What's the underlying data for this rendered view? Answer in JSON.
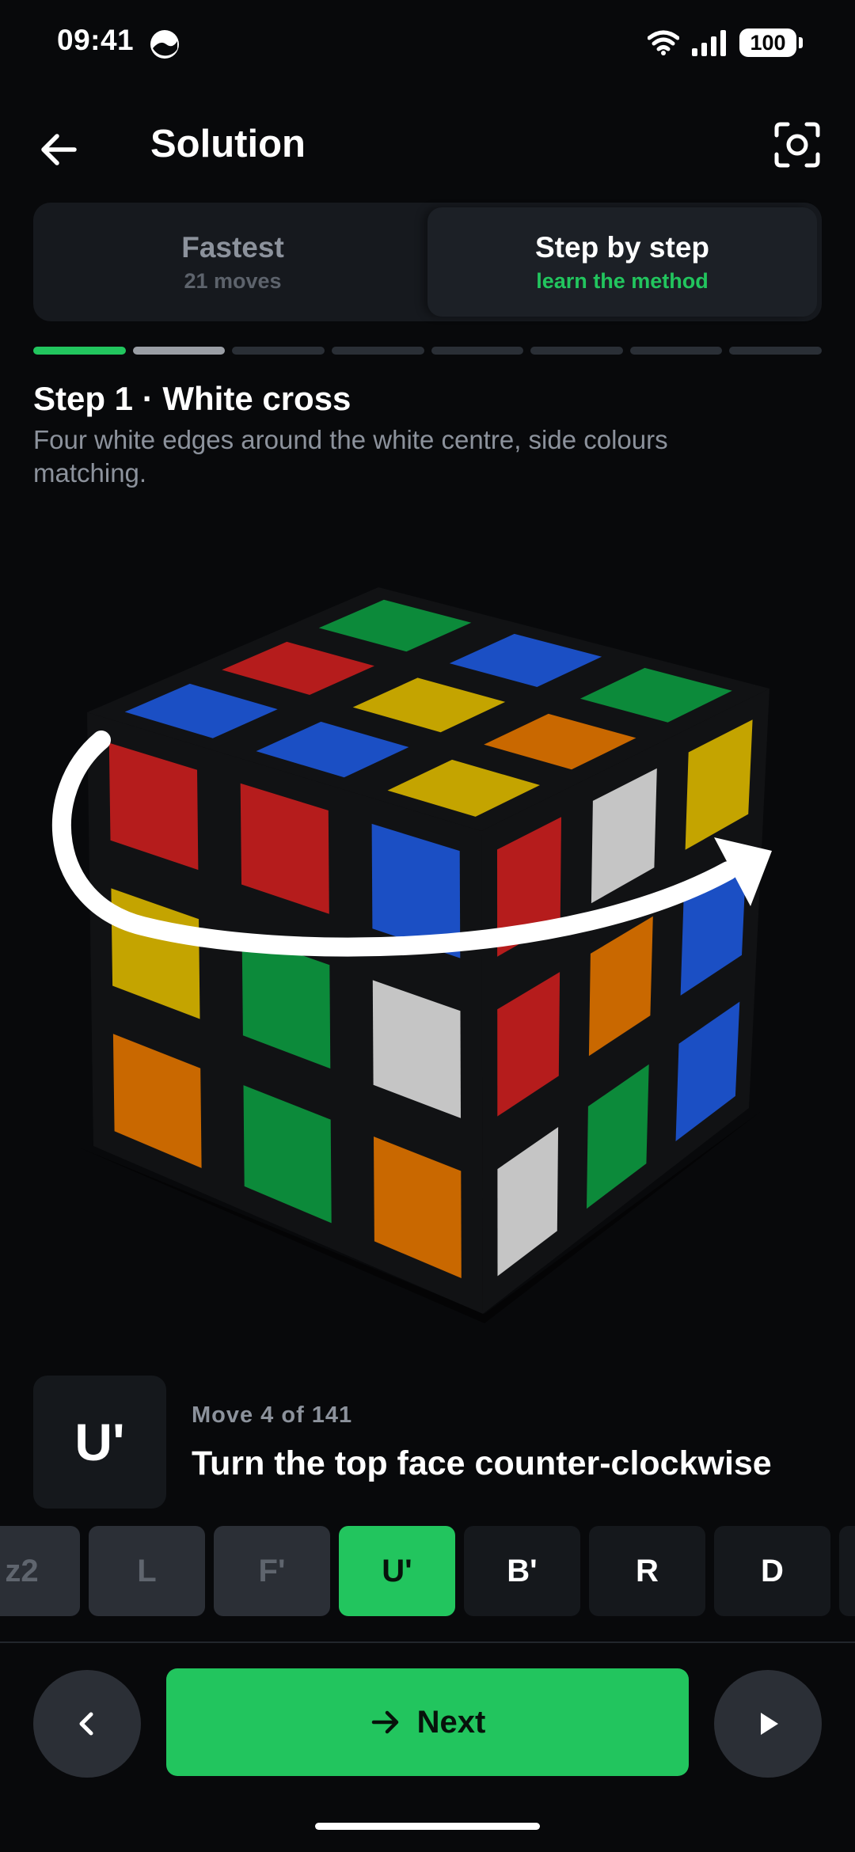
{
  "status_bar": {
    "time": "09:41",
    "battery": "100"
  },
  "header": {
    "title": "Solution"
  },
  "tabs": [
    {
      "label": "Fastest",
      "sub": "21 moves",
      "active": false
    },
    {
      "label": "Step by step",
      "sub": "learn the method",
      "active": true
    }
  ],
  "step_progress": {
    "total": 8,
    "done": 1,
    "current": 2
  },
  "step": {
    "title": "Step 1 · White cross",
    "description": "Four white edges around the white centre, side colours matching."
  },
  "move": {
    "notation": "U'",
    "counter": "Move 4 of 141",
    "description": "Turn the top face counter-clockwise"
  },
  "move_strip": [
    {
      "label": "z2",
      "state": "past"
    },
    {
      "label": "L",
      "state": "past"
    },
    {
      "label": "F'",
      "state": "past"
    },
    {
      "label": "U'",
      "state": "now"
    },
    {
      "label": "B'",
      "state": "next"
    },
    {
      "label": "R",
      "state": "next"
    },
    {
      "label": "D",
      "state": "next"
    },
    {
      "label": "",
      "state": "next"
    }
  ],
  "nav": {
    "next_label": "Next"
  },
  "colors": {
    "accent": "#22c55e",
    "cube_white": "#c5c5c5",
    "cube_yellow": "#c4a400",
    "cube_red": "#b51c1c",
    "cube_orange": "#c96800",
    "cube_blue": "#1b4fc4",
    "cube_green": "#0c8a3a"
  },
  "cube": {
    "top": [
      [
        "green",
        "blue",
        "green"
      ],
      [
        "red",
        "yellow",
        "orange"
      ],
      [
        "blue",
        "blue",
        "yellow"
      ]
    ],
    "front": [
      [
        "red",
        "red",
        "blue"
      ],
      [
        "yellow",
        "green",
        "white"
      ],
      [
        "orange",
        "green",
        "orange"
      ]
    ],
    "right": [
      [
        "red",
        "white",
        "yellow"
      ],
      [
        "red",
        "orange",
        "blue"
      ],
      [
        "white",
        "green",
        "blue"
      ]
    ]
  }
}
